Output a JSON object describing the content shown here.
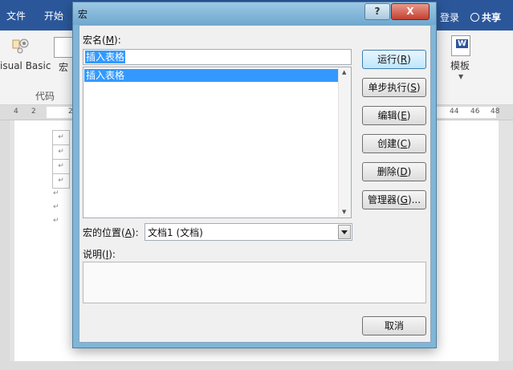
{
  "word": {
    "tabs": [
      "文件",
      "开始"
    ],
    "login": "登录",
    "share": "共享",
    "ribbon": {
      "visual_basic": "isual Basic",
      "macro": "宏",
      "group_code": "代码",
      "template": "模板"
    },
    "ruler_left": [
      "4",
      "2",
      "2"
    ],
    "ruler_right": [
      "44",
      "46",
      "48"
    ]
  },
  "dialog": {
    "title": "宏",
    "help": "?",
    "close": "X",
    "macro_name": {
      "label": "宏名(",
      "key": "M",
      "tail": "):",
      "value": "插入表格"
    },
    "macro_list": [
      "插入表格"
    ],
    "buttons": {
      "run": {
        "label": "运行(",
        "key": "R",
        "tail": ")"
      },
      "step": {
        "label": "单步执行(",
        "key": "S",
        "tail": ")"
      },
      "edit": {
        "label": "编辑(",
        "key": "E",
        "tail": ")"
      },
      "create": {
        "label": "创建(",
        "key": "C",
        "tail": ")"
      },
      "delete": {
        "label": "删除(",
        "key": "D",
        "tail": ")"
      },
      "organizer": {
        "label": "管理器(",
        "key": "G",
        "tail": ")..."
      },
      "cancel": {
        "label": "取消"
      }
    },
    "macros_in": {
      "label": "宏的位置(",
      "key": "A",
      "tail": "):",
      "value": "文档1 (文档)"
    },
    "description": {
      "label": "说明(",
      "key": "I",
      "tail": "):",
      "value": ""
    }
  }
}
